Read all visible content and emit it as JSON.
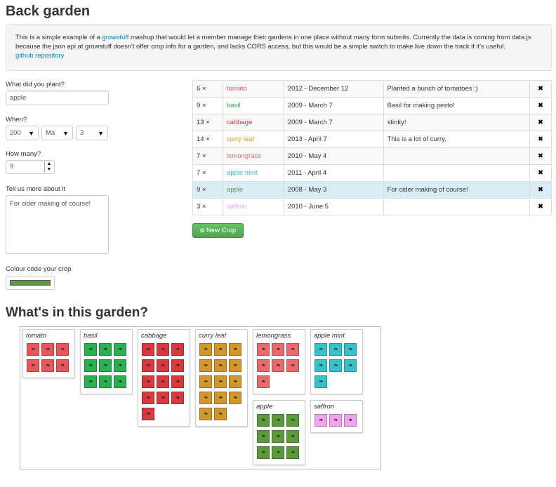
{
  "title": "Back garden",
  "intro": {
    "text1": "This is a simple example of a ",
    "link1": "growstuff",
    "text2": " mashup that would let a member manage their gardens in one place without many form submits. Currently the data is coming from data.js because the json api at growstuff doesn't offer crop info for a garden, and lacks CORS access, but this would be a simple switch to make live down the track if it's useful.",
    "link2": "github repository"
  },
  "form": {
    "plant_label": "What did you plant?",
    "plant_value": "apple",
    "when_label": "When?",
    "year_value": "200",
    "month_value": "Ma",
    "day_value": "3",
    "count_label": "How many?",
    "count_value": "9",
    "about_label": "Tell us more about it",
    "about_value": "For cider making of course!",
    "colour_label": "Colour code your crop",
    "colour_value": "#5a9a3a"
  },
  "crops": [
    {
      "qty": "6 ×",
      "name": "tomato",
      "color": "#e8555a",
      "planted": "2012 - December 12",
      "note": "Planted a bunch of tomatoes :)",
      "remove": "✖"
    },
    {
      "qty": "9 ×",
      "name": "basil",
      "color": "#2ab04f",
      "planted": "2009 - March 7",
      "note": "Basil for making pesto!",
      "remove": "✖"
    },
    {
      "qty": "13 ×",
      "name": "cabbage",
      "color": "#d9383c",
      "planted": "2009 - March 7",
      "note": "stinky!",
      "remove": "✖"
    },
    {
      "qty": "14 ×",
      "name": "curry leaf",
      "color": "#d4952a",
      "planted": "2013 - April 7",
      "note": "This is a lot of curry.",
      "remove": "✖"
    },
    {
      "qty": "7 ×",
      "name": "lemongrass",
      "color": "#e86a6a",
      "planted": "2010 - May 4",
      "note": "",
      "remove": "✖"
    },
    {
      "qty": "7 ×",
      "name": "apple mint",
      "color": "#35c2c8",
      "planted": "2011 - April 4",
      "note": "",
      "remove": "✖"
    },
    {
      "qty": "9 ×",
      "name": "apple",
      "color": "#5a9a3a",
      "planted": "2008 - May 3",
      "note": "For cider making of course!",
      "remove": "✖"
    },
    {
      "qty": "3 ×",
      "name": "saffron",
      "color": "#f2a2ee",
      "planted": "2010 - June 5",
      "note": "",
      "remove": "✖"
    }
  ],
  "new_crop_label": "New Crop",
  "garden_title": "What's in this garden?",
  "garden": [
    {
      "name": "tomato",
      "count": 6,
      "color": "#e8555a"
    },
    {
      "name": "basil",
      "count": 9,
      "color": "#2ab04f"
    },
    {
      "name": "cabbage",
      "count": 13,
      "color": "#d9383c"
    },
    {
      "name": "curry leaf",
      "count": 14,
      "color": "#d4952a"
    },
    {
      "name": "lemongrass",
      "count": 7,
      "color": "#e86a6a"
    },
    {
      "name": "apple mint",
      "count": 7,
      "color": "#35c2c8"
    },
    {
      "name": "apple",
      "count": 9,
      "color": "#5a9a3a"
    },
    {
      "name": "saffron",
      "count": 3,
      "color": "#f2a2ee"
    }
  ],
  "icons": {
    "leaf": "leaf-icon",
    "remove": "remove-icon",
    "spinner_up": "▲",
    "spinner_down": "▼",
    "caret": "▼"
  }
}
